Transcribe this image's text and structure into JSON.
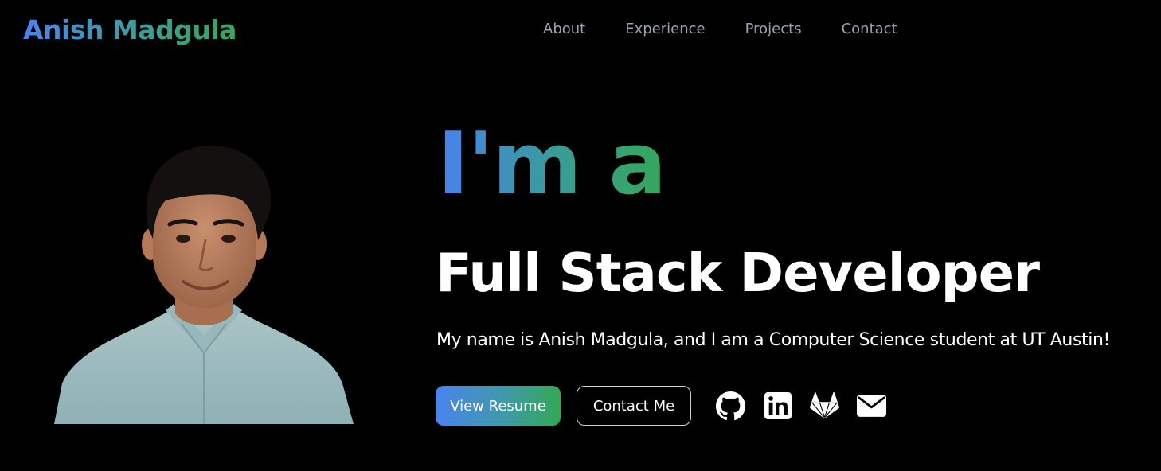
{
  "header": {
    "logo": "Anish Madgula",
    "nav": [
      {
        "label": "About"
      },
      {
        "label": "Experience"
      },
      {
        "label": "Projects"
      },
      {
        "label": "Contact"
      }
    ]
  },
  "hero": {
    "lead": "I'm a",
    "role": "Full Stack Developer",
    "description": "My name is Anish Madgula, and I am a Computer Science student at UT Austin!",
    "buttons": {
      "primary": "View Resume",
      "secondary": "Contact Me"
    },
    "socials": [
      {
        "icon": "github-icon"
      },
      {
        "icon": "linkedin-icon"
      },
      {
        "icon": "gitlab-icon"
      },
      {
        "icon": "envelope-icon"
      }
    ]
  },
  "colors": {
    "background": "#000000",
    "gradient_blue": "#4a84ee",
    "gradient_green": "#34a853",
    "nav_text": "#9aa3b2",
    "text": "#ffffff"
  }
}
